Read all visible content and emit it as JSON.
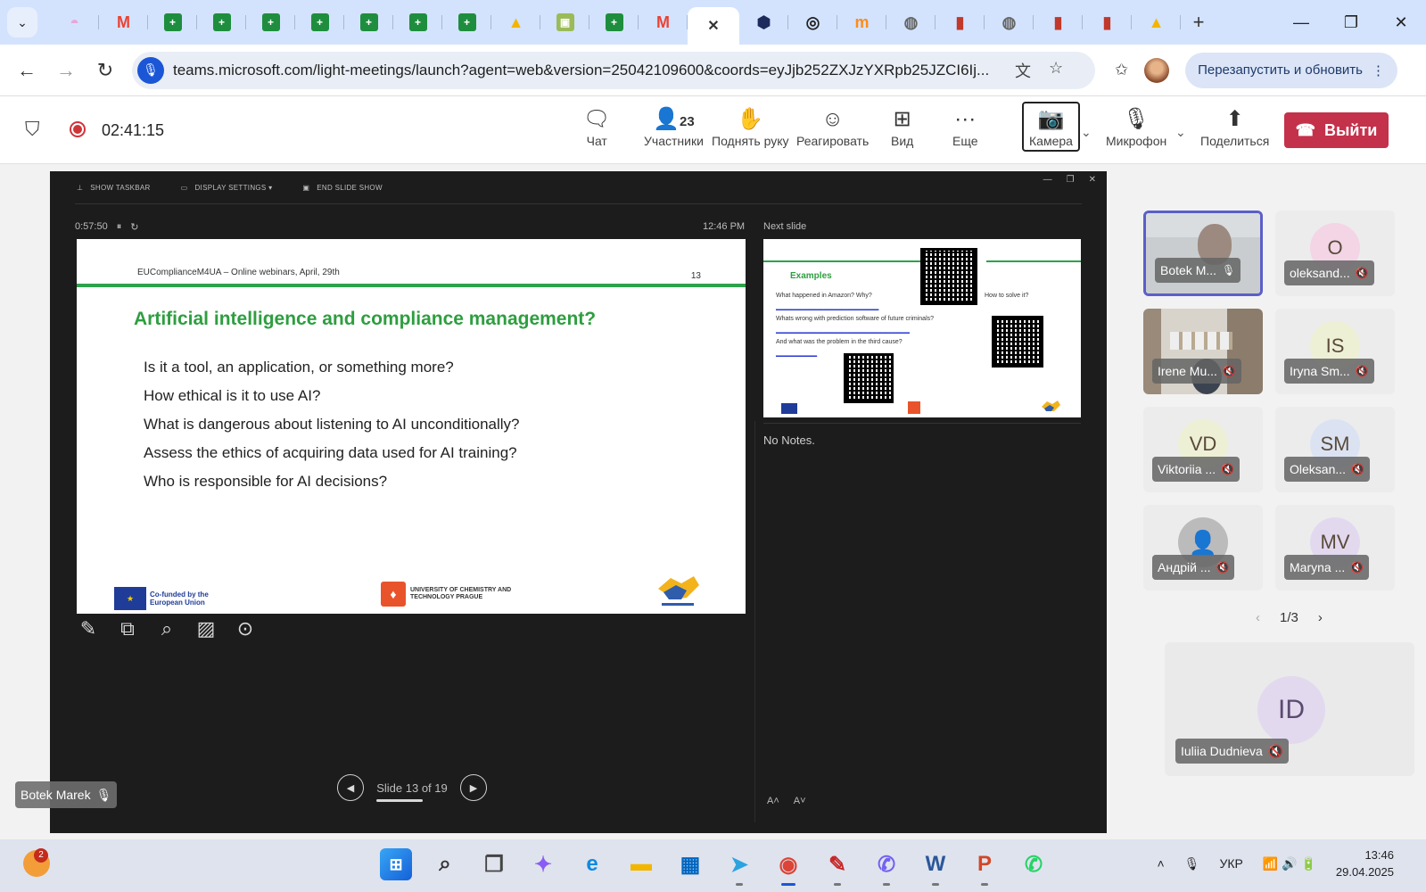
{
  "browser": {
    "url": "teams.microsoft.com/light-meetings/launch?agent=web&version=25042109600&coords=eyJjb252ZXJzYXRpb25JZCI6Ij...",
    "update_button": "Перезапустить и обновить",
    "tabs": [
      {
        "icon": "copilot-icon",
        "color": "#e8a7d8",
        "glyph": "◓"
      },
      {
        "icon": "gmail-icon",
        "color": "#ea4335",
        "glyph": "M"
      },
      {
        "icon": "sheets-icon",
        "color": "#1e8e3e",
        "glyph": "+"
      },
      {
        "icon": "sheets-icon",
        "color": "#1e8e3e",
        "glyph": "+"
      },
      {
        "icon": "sheets-icon",
        "color": "#1e8e3e",
        "glyph": "+"
      },
      {
        "icon": "sheets-icon",
        "color": "#1e8e3e",
        "glyph": "+"
      },
      {
        "icon": "sheets-icon",
        "color": "#1e8e3e",
        "glyph": "+"
      },
      {
        "icon": "sheets-icon",
        "color": "#1e8e3e",
        "glyph": "+"
      },
      {
        "icon": "sheets-icon",
        "color": "#1e8e3e",
        "glyph": "+"
      },
      {
        "icon": "drive-icon",
        "color": "#f4b400",
        "glyph": "▲"
      },
      {
        "icon": "classroom-icon",
        "color": "#9bbb59",
        "glyph": "▣"
      },
      {
        "icon": "sheets-icon",
        "color": "#1e8e3e",
        "glyph": "+"
      },
      {
        "icon": "gmail-icon",
        "color": "#ea4335",
        "glyph": "M"
      },
      {
        "icon": "close-icon",
        "color": "#ffffff",
        "glyph": "✕",
        "active": true
      },
      {
        "icon": "teams-shield-icon",
        "color": "#1c2b5c",
        "glyph": "⬢"
      },
      {
        "icon": "target-icon",
        "color": "#222222",
        "glyph": "◎"
      },
      {
        "icon": "mooc-icon",
        "color": "#ff8c1a",
        "glyph": "m"
      },
      {
        "icon": "globe-icon",
        "color": "#666666",
        "glyph": "◍"
      },
      {
        "icon": "bookmark-icon",
        "color": "#c0392b",
        "glyph": "▮"
      },
      {
        "icon": "globe-icon",
        "color": "#666666",
        "glyph": "◍"
      },
      {
        "icon": "bookmark-icon",
        "color": "#c0392b",
        "glyph": "▮"
      },
      {
        "icon": "bookmark-icon",
        "color": "#c0392b",
        "glyph": "▮"
      },
      {
        "icon": "drive-icon",
        "color": "#f4b400",
        "glyph": "▲"
      }
    ]
  },
  "meeting": {
    "elapsed": "02:41:15",
    "toolbar": {
      "chat": "Чат",
      "participants": "Участники",
      "participants_count": "23",
      "raise_hand": "Поднять руку",
      "react": "Реагировать",
      "view": "Вид",
      "more": "Еще",
      "camera": "Камера",
      "mic": "Микрофон",
      "share": "Поделиться",
      "leave": "Выйти"
    }
  },
  "presentation": {
    "toolbar": {
      "show_taskbar": "SHOW TASKBAR",
      "display_settings": "DISPLAY SETTINGS ▾",
      "end_show": "END SLIDE SHOW"
    },
    "timer": "0:57:50",
    "clock": "12:46 PM",
    "next_slide_label": "Next slide",
    "notes": "No Notes.",
    "slide_counter": "Slide 13 of 19",
    "presenter": "Botek Marek",
    "slide": {
      "header": "EUComplianceM4UA – Online webinars, April, 29th",
      "number": "13",
      "title": "Artificial intelligence and compliance management?",
      "bullets": [
        "Is it a tool, an application, or something more?",
        "How ethical is it to use AI?",
        "What is dangerous about listening to AI unconditionally?",
        "Assess the ethics of acquiring data used for AI training?",
        "Who is responsible for AI decisions?"
      ],
      "eu_text": "Co-funded by the European Union",
      "uct_text": "UNIVERSITY OF CHEMISTRY AND TECHNOLOGY PRAGUE"
    },
    "next": {
      "title": "Examples",
      "q1": "What happened in Amazon? Why?",
      "q2": "Whats wrong with prediction software of future criminals?",
      "q3": "And what was the problem in the third cause?",
      "q4": "How to solve it?"
    }
  },
  "participants": {
    "tiles": [
      {
        "name": "Botek M...",
        "initials": "",
        "bg": "#ececec",
        "photo": "1",
        "active": true,
        "mic": "on"
      },
      {
        "name": "oleksand...",
        "initials": "O",
        "bg": "#f3d5e6",
        "photo": "",
        "active": false,
        "mic": "off"
      },
      {
        "name": "Irene Mu...",
        "initials": "",
        "bg": "#ececec",
        "photo": "2",
        "active": false,
        "mic": "off"
      },
      {
        "name": "Iryna Sm...",
        "initials": "IS",
        "bg": "#eef0d6",
        "photo": "",
        "active": false,
        "mic": "off"
      },
      {
        "name": "Viktoriia ...",
        "initials": "VD",
        "bg": "#eef0d6",
        "photo": "",
        "active": false,
        "mic": "off"
      },
      {
        "name": "Oleksan...",
        "initials": "SM",
        "bg": "#dbe3f3",
        "photo": "",
        "active": false,
        "mic": "off"
      },
      {
        "name": "Андрій ...",
        "initials": "👤",
        "bg": "#bbbbbb",
        "photo": "",
        "active": false,
        "mic": "off"
      },
      {
        "name": "Maryna ...",
        "initials": "MV",
        "bg": "#e2d9ef",
        "photo": "",
        "active": false,
        "mic": "off"
      }
    ],
    "page": "1/3",
    "large": {
      "name": "Iuliia Dudnieva",
      "initials": "ID"
    }
  },
  "taskbar": {
    "notification_count": "2",
    "lang": "УКР",
    "time": "13:46",
    "date": "29.04.2025",
    "apps": [
      {
        "icon": "windows-start-icon",
        "glyph": "⊞",
        "color": "#1a73e8",
        "cls": "win",
        "dot": ""
      },
      {
        "icon": "search-icon",
        "glyph": "⌕",
        "color": "#333333",
        "cls": "",
        "dot": ""
      },
      {
        "icon": "task-view-icon",
        "glyph": "❐",
        "color": "#444444",
        "cls": "",
        "dot": ""
      },
      {
        "icon": "copilot-icon",
        "glyph": "✦",
        "color": "#8a5cf5",
        "cls": "",
        "dot": ""
      },
      {
        "icon": "edge-icon",
        "glyph": "e",
        "color": "#0f8adf",
        "cls": "",
        "dot": ""
      },
      {
        "icon": "file-explorer-icon",
        "glyph": "▬",
        "color": "#f2b600",
        "cls": "",
        "dot": ""
      },
      {
        "icon": "store-icon",
        "glyph": "▦",
        "color": "#0067c0",
        "cls": "",
        "dot": ""
      },
      {
        "icon": "telegram-icon",
        "glyph": "➤",
        "color": "#2aa3e0",
        "cls": "",
        "dot": "yes"
      },
      {
        "icon": "chrome-icon",
        "glyph": "◉",
        "color": "#db4437",
        "cls": "",
        "dot": "act"
      },
      {
        "icon": "pdf-editor-icon",
        "glyph": "✎",
        "color": "#c62828",
        "cls": "",
        "dot": "yes"
      },
      {
        "icon": "viber-icon",
        "glyph": "✆",
        "color": "#7360f2",
        "cls": "",
        "dot": "yes"
      },
      {
        "icon": "word-icon",
        "glyph": "W",
        "color": "#2b579a",
        "cls": "",
        "dot": "yes"
      },
      {
        "icon": "powerpoint-icon",
        "glyph": "P",
        "color": "#d24726",
        "cls": "",
        "dot": "yes"
      },
      {
        "icon": "whatsapp-icon",
        "glyph": "✆",
        "color": "#25d366",
        "cls": "",
        "dot": ""
      }
    ]
  }
}
